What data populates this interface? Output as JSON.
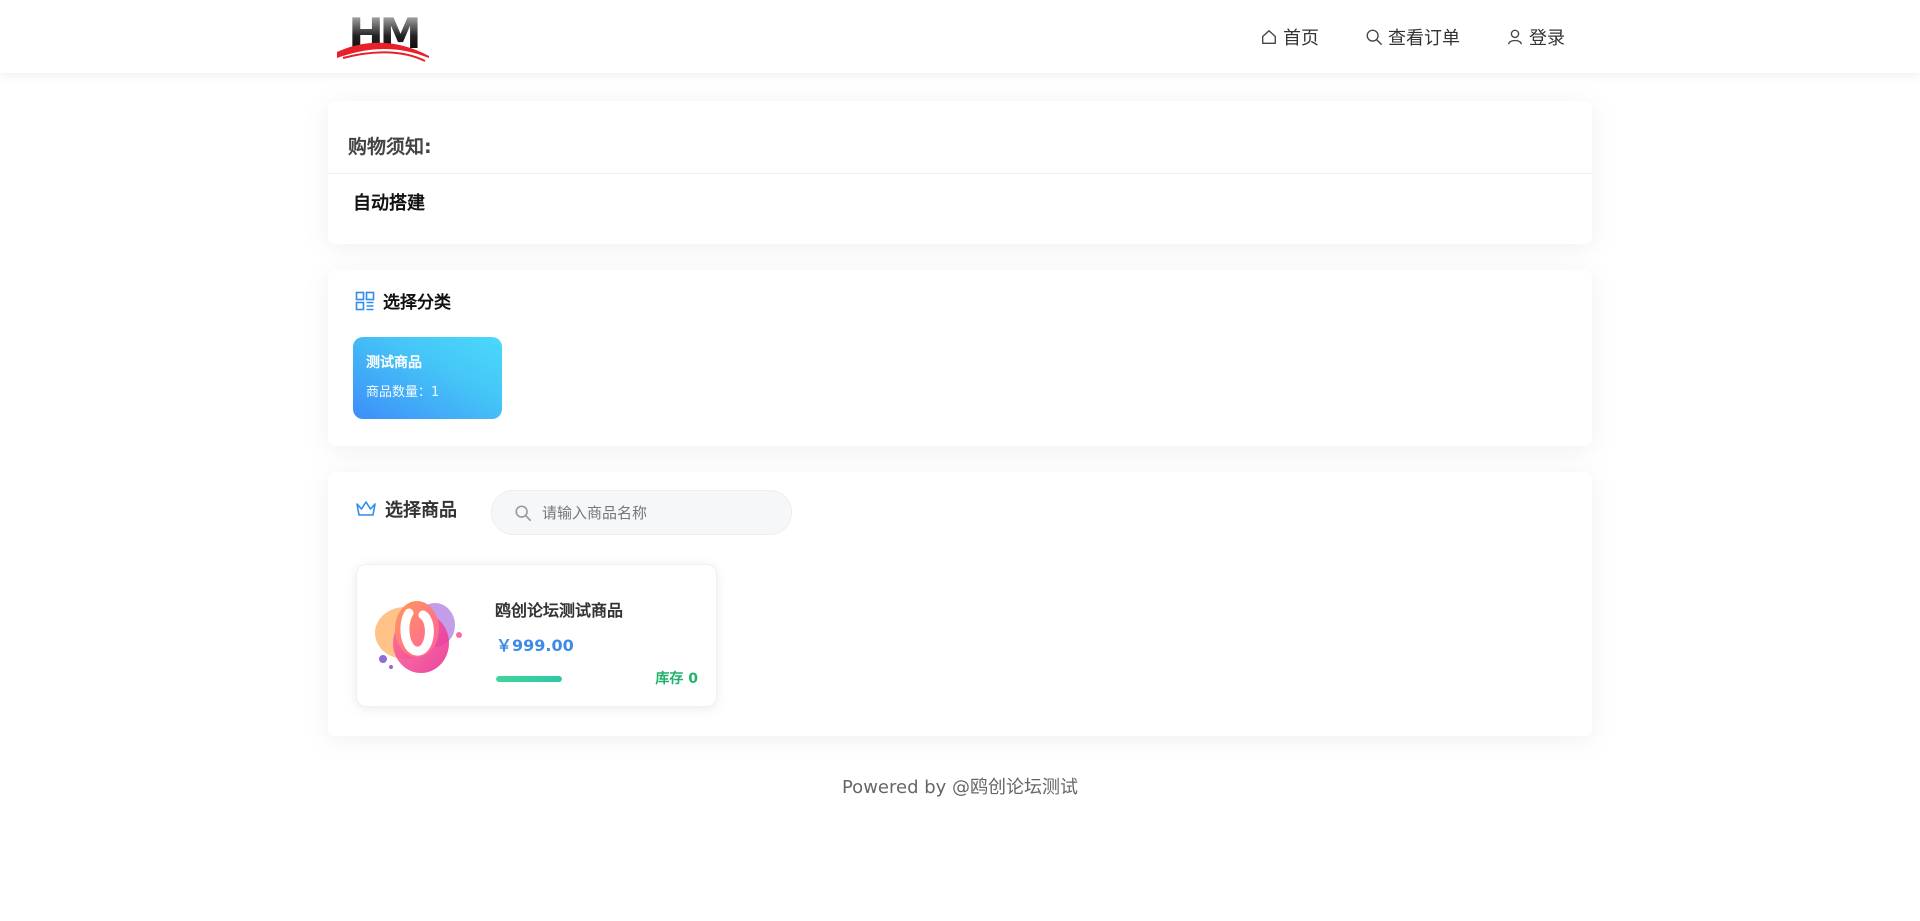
{
  "header": {
    "logo_text": "HM",
    "nav": [
      {
        "label": "首页",
        "icon": "home-icon"
      },
      {
        "label": "查看订单",
        "icon": "search-icon"
      },
      {
        "label": "登录",
        "icon": "user-icon"
      }
    ]
  },
  "notice": {
    "title": "购物须知:",
    "body": "自动搭建"
  },
  "category": {
    "title": "选择分类",
    "icon": "grid-icon",
    "items": [
      {
        "name": "测试商品",
        "count_label": "商品数量：1"
      }
    ]
  },
  "goods": {
    "title": "选择商品",
    "icon": "crown-icon",
    "search_placeholder": "请输入商品名称",
    "items": [
      {
        "name": "鸥创论坛测试商品",
        "price": "￥999.00",
        "stock_label": "库存 0",
        "stock_fill_percent": 100
      }
    ]
  },
  "footer": {
    "text": "Powered by @鸥创论坛测试"
  },
  "colors": {
    "accent_blue": "#3d8ae8",
    "stock_green": "#22b06b"
  }
}
